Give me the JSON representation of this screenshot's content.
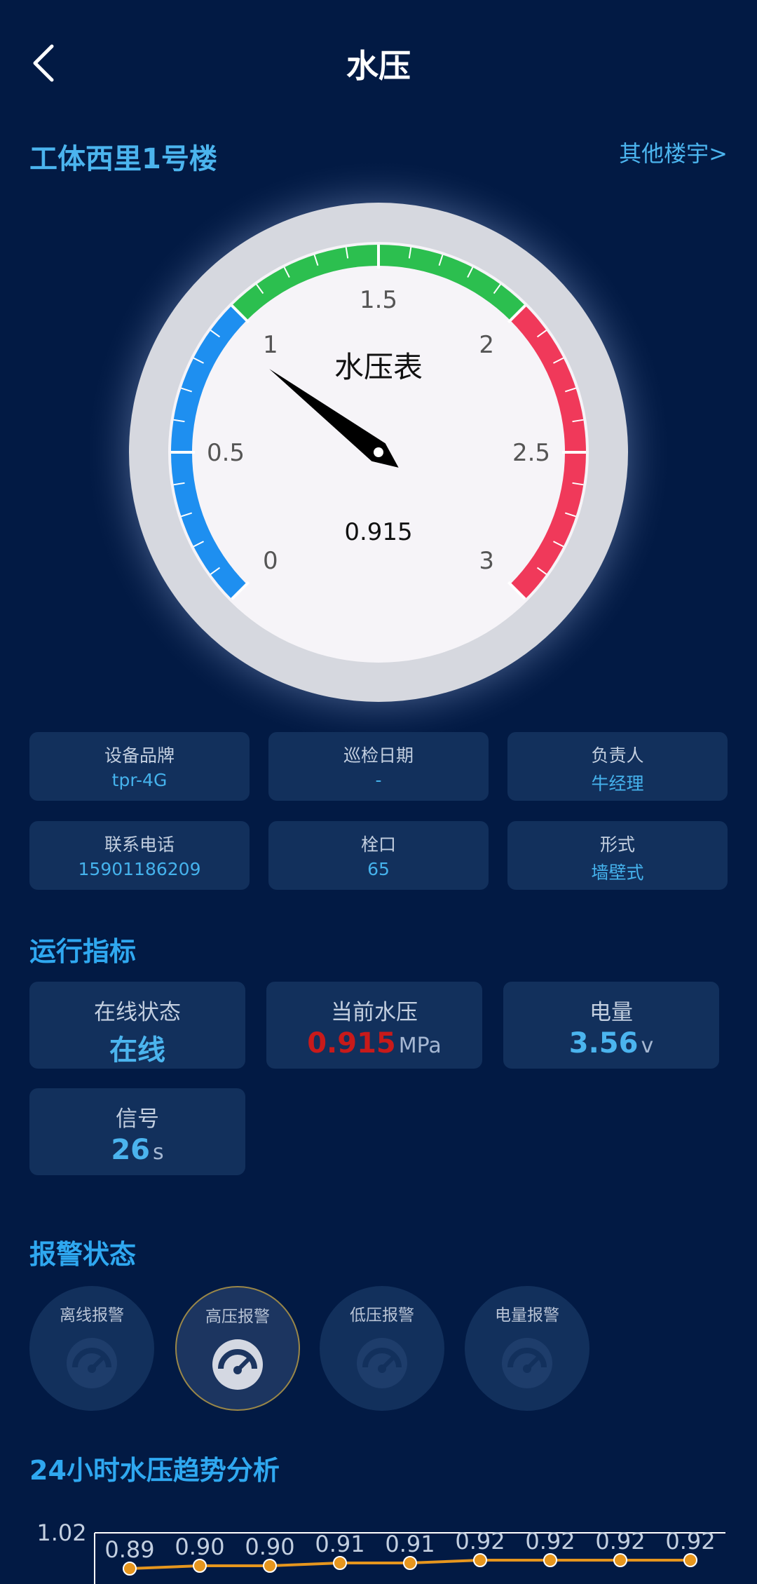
{
  "header": {
    "title": "水压"
  },
  "building": {
    "name": "工体西里1号楼",
    "other_link": "其他楼宇>"
  },
  "gauge": {
    "title": "水压表",
    "value": 0.915,
    "value_text": "0.915",
    "min": 0,
    "max": 3,
    "tick_labels": [
      "0",
      "0.5",
      "1",
      "1.5",
      "2",
      "2.5",
      "3"
    ],
    "zones": [
      {
        "from": 0,
        "to": 1,
        "color": "#1e8ff0"
      },
      {
        "from": 1,
        "to": 2,
        "color": "#2cbf4f"
      },
      {
        "from": 2,
        "to": 3,
        "color": "#f0395a"
      }
    ]
  },
  "info": [
    {
      "label": "设备品牌",
      "value": "tpr-4G"
    },
    {
      "label": "巡检日期",
      "value": "-"
    },
    {
      "label": "负责人",
      "value": "牛经理"
    },
    {
      "label": "联系电话",
      "value": "15901186209"
    },
    {
      "label": "栓口",
      "value": "65"
    },
    {
      "label": "形式",
      "value": "墙壁式"
    }
  ],
  "metrics_section": {
    "title": "运行指标"
  },
  "metrics": [
    {
      "label": "在线状态",
      "value": "在线",
      "unit": ""
    },
    {
      "label": "当前水压",
      "value": "0.915",
      "unit": "MPa"
    },
    {
      "label": "电量",
      "value": "3.56",
      "unit": "v"
    },
    {
      "label": "信号",
      "value": "26",
      "unit": "s"
    }
  ],
  "alarm_section": {
    "title": "报警状态"
  },
  "alarms": [
    {
      "label": "离线报警",
      "active": false
    },
    {
      "label": "高压报警",
      "active": true
    },
    {
      "label": "低压报警",
      "active": false
    },
    {
      "label": "电量报警",
      "active": false
    }
  ],
  "trend_section": {
    "title": "24小时水压趋势分析"
  },
  "colors": {
    "background": "#021a44",
    "card": "#12305c",
    "accent": "#2fa8f0",
    "line": "#e6961e",
    "red_value": "#c81a1a"
  },
  "chart_data": {
    "type": "line",
    "y_tick_labels": [
      "1.02"
    ],
    "series": [
      {
        "values": [
          0.89,
          0.9,
          0.9,
          0.91,
          0.91,
          0.92,
          0.92,
          0.92,
          0.92
        ]
      }
    ],
    "data_labels": [
      "0.89",
      "0.90",
      "0.90",
      "0.91",
      "0.91",
      "0.92",
      "0.92",
      "0.92",
      "0.92"
    ]
  }
}
